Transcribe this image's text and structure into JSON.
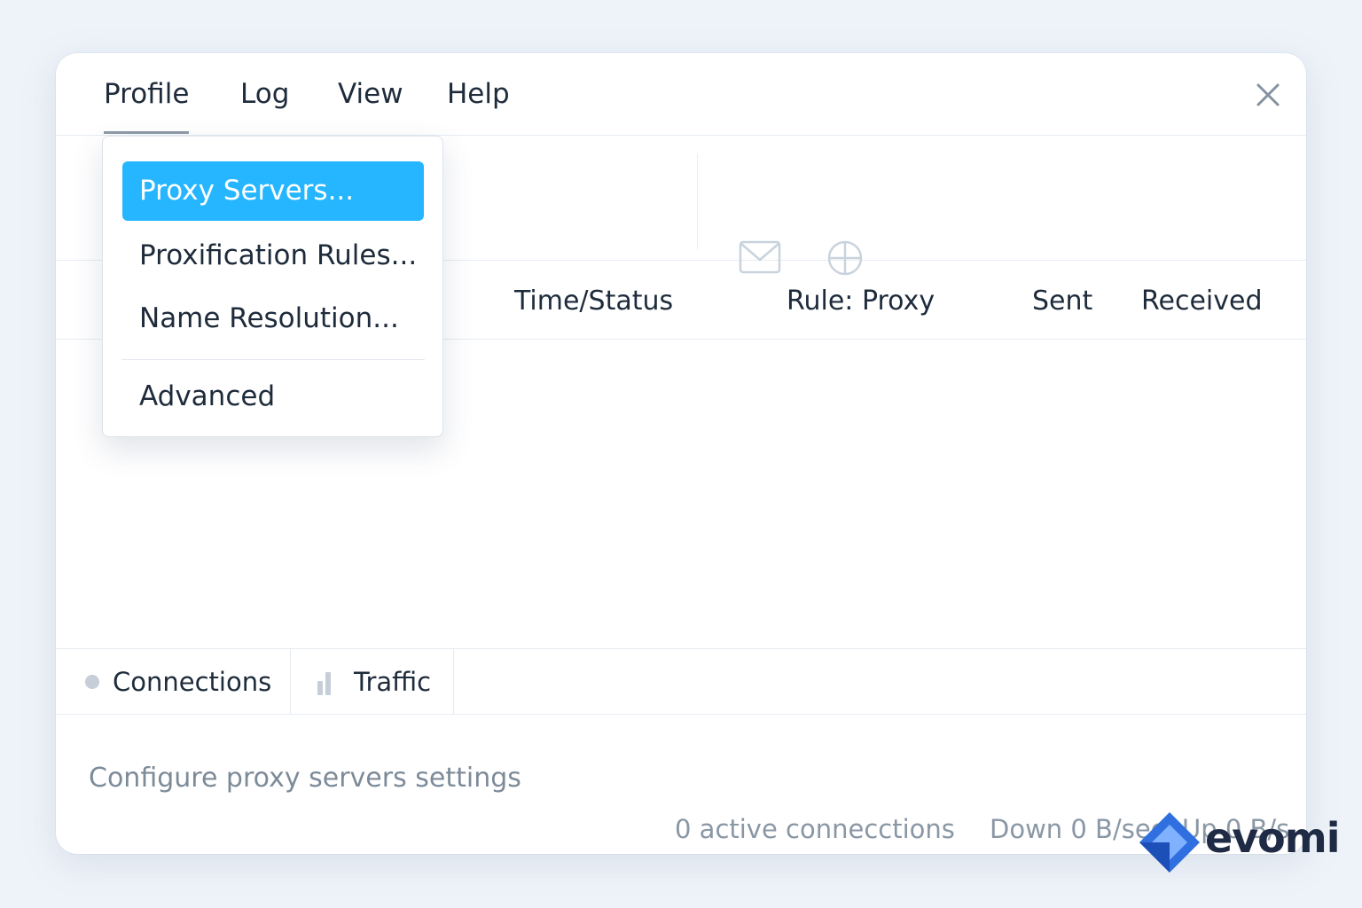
{
  "menubar": {
    "items": [
      {
        "label": "Profile"
      },
      {
        "label": "Log"
      },
      {
        "label": "View"
      },
      {
        "label": "Help"
      }
    ],
    "active": "Profile"
  },
  "profile_menu": {
    "items": [
      {
        "label": "Proxy Servers...",
        "selected": true
      },
      {
        "label": "Proxification Rules..."
      },
      {
        "label": "Name Resolution..."
      },
      {
        "label": "Advanced"
      }
    ]
  },
  "toolbar": {
    "icons": [
      "mail-icon",
      "globe-icon"
    ]
  },
  "table": {
    "columns": [
      "Time/Status",
      "Rule: Proxy",
      "Sent",
      "Received"
    ]
  },
  "tabs": [
    {
      "label": "Connections",
      "icon": "status-dot-icon"
    },
    {
      "label": "Traffic",
      "icon": "bar-chart-icon"
    }
  ],
  "hint": "Configure proxy servers settings",
  "status": {
    "connections": "0 active conneccti﻿ons",
    "down": "Down 0 B/sec",
    "up": "Up 0 B/s"
  },
  "watermark": {
    "text": "evomi"
  },
  "colors": {
    "accent": "#25b6ff",
    "background": "#eef3f9",
    "logo_blue": "#2f6fe0"
  }
}
